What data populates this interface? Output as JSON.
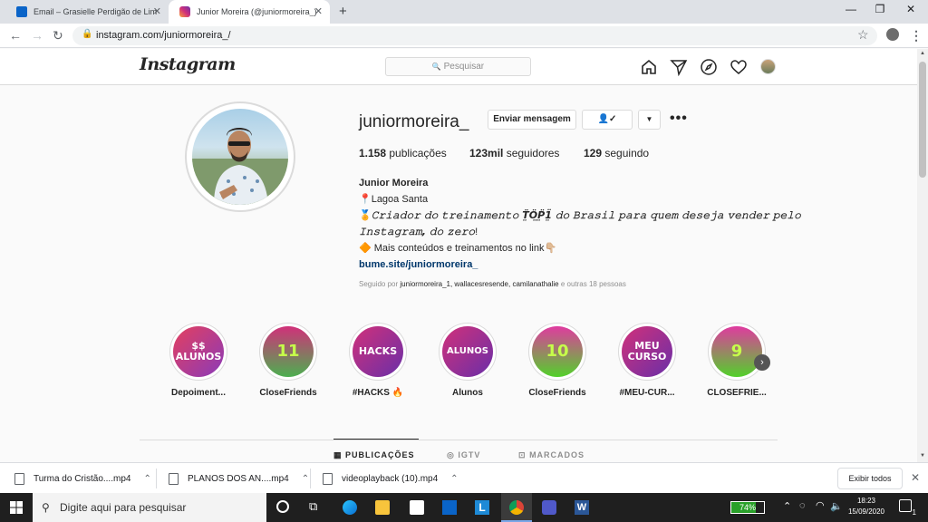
{
  "browser": {
    "tabs": [
      {
        "title": "Email – Grasielle Perdigão de Lim",
        "active": false
      },
      {
        "title": "Junior Moreira (@juniormoreira_)",
        "active": true
      }
    ],
    "url": "instagram.com/juniormoreira_/"
  },
  "instagram": {
    "logo": "Instagram",
    "search_placeholder": "Pesquisar",
    "profile": {
      "username": "juniormoreira_",
      "message_button": "Enviar mensagem",
      "follow_icon": "person-check-icon",
      "stats": {
        "posts_count": "1.158",
        "posts_label": "publicações",
        "followers_count": "123mil",
        "followers_label": "seguidores",
        "following_count": "129",
        "following_label": "seguindo"
      },
      "bio": {
        "name": "Junior Moreira",
        "line1": "📍Lagoa Santa",
        "line2a": "🏅",
        "line2b": "𝙲𝚛𝚒𝚊𝚍𝚘𝚛 𝚍𝚘 𝚝𝚛𝚎𝚒𝚗𝚊𝚖𝚎𝚗𝚝𝚘 T̤̈Ö̤P̤̈1̤̈ 𝚍𝚘 𝙱𝚛𝚊𝚜𝚒𝚕 𝚙𝚊𝚛𝚊 𝚚𝚞𝚎𝚖 𝚍𝚎𝚜𝚎𝚓𝚊 𝚟𝚎𝚗𝚍𝚎𝚛 𝚙𝚎𝚕𝚘",
        "line3a": "𝙸𝚗𝚜𝚝𝚊𝚐𝚛𝚊𝚖, 𝚍𝚘 𝚣𝚎𝚛𝚘",
        "line3b": "!",
        "line4": "🔶 Mais conteúdos e treinamentos no link👇🏼",
        "link": "bume.site/juniormoreira_"
      },
      "followed_by_prefix": "Seguido por",
      "followed_by_names": "juniormoreira_1, wallacesresende, camilanathalie",
      "followed_by_suffix": "e outras 18 pessoas"
    },
    "highlights": [
      {
        "cover": "$$ ALUNOS",
        "label": "Depoiment...",
        "gradient": [
          "#e4405f",
          "#8a3ab9"
        ]
      },
      {
        "cover": "11",
        "label": "CloseFriends",
        "gradient": [
          "#d1307a",
          "#4caf50"
        ]
      },
      {
        "cover": "HACKS",
        "label": "#HACKS 🔥",
        "gradient": [
          "#d1307a",
          "#6a2fa8"
        ]
      },
      {
        "cover": "ALUNOS",
        "label": "Alunos",
        "gradient": [
          "#d1307a",
          "#6a2fa8"
        ]
      },
      {
        "cover": "10",
        "label": "CloseFriends",
        "gradient": [
          "#e03aa0",
          "#52d12a"
        ]
      },
      {
        "cover": "MEU CURSO",
        "label": "#MEU-CUR...",
        "gradient": [
          "#d1307a",
          "#6a2fa8"
        ]
      },
      {
        "cover": "9",
        "label": "CLOSEFRIE...",
        "gradient": [
          "#e03aa0",
          "#52d12a"
        ]
      }
    ],
    "profile_tabs": [
      {
        "label": "PUBLICAÇÕES",
        "icon": "grid-icon",
        "active": true
      },
      {
        "label": "IGTV",
        "icon": "igtv-icon",
        "active": false
      },
      {
        "label": "MARCADOS",
        "icon": "tag-icon",
        "active": false
      }
    ]
  },
  "downloads": {
    "items": [
      {
        "name": "Turma do Cristão....mp4"
      },
      {
        "name": "PLANOS DOS AN....mp4"
      },
      {
        "name": "videoplayback (10).mp4"
      }
    ],
    "show_all": "Exibir todos"
  },
  "taskbar": {
    "search_placeholder": "Digite aqui para pesquisar",
    "battery": "74%",
    "battery_level": 0.74,
    "time": "18:23",
    "date": "15/09/2020",
    "notification_count": "1"
  }
}
